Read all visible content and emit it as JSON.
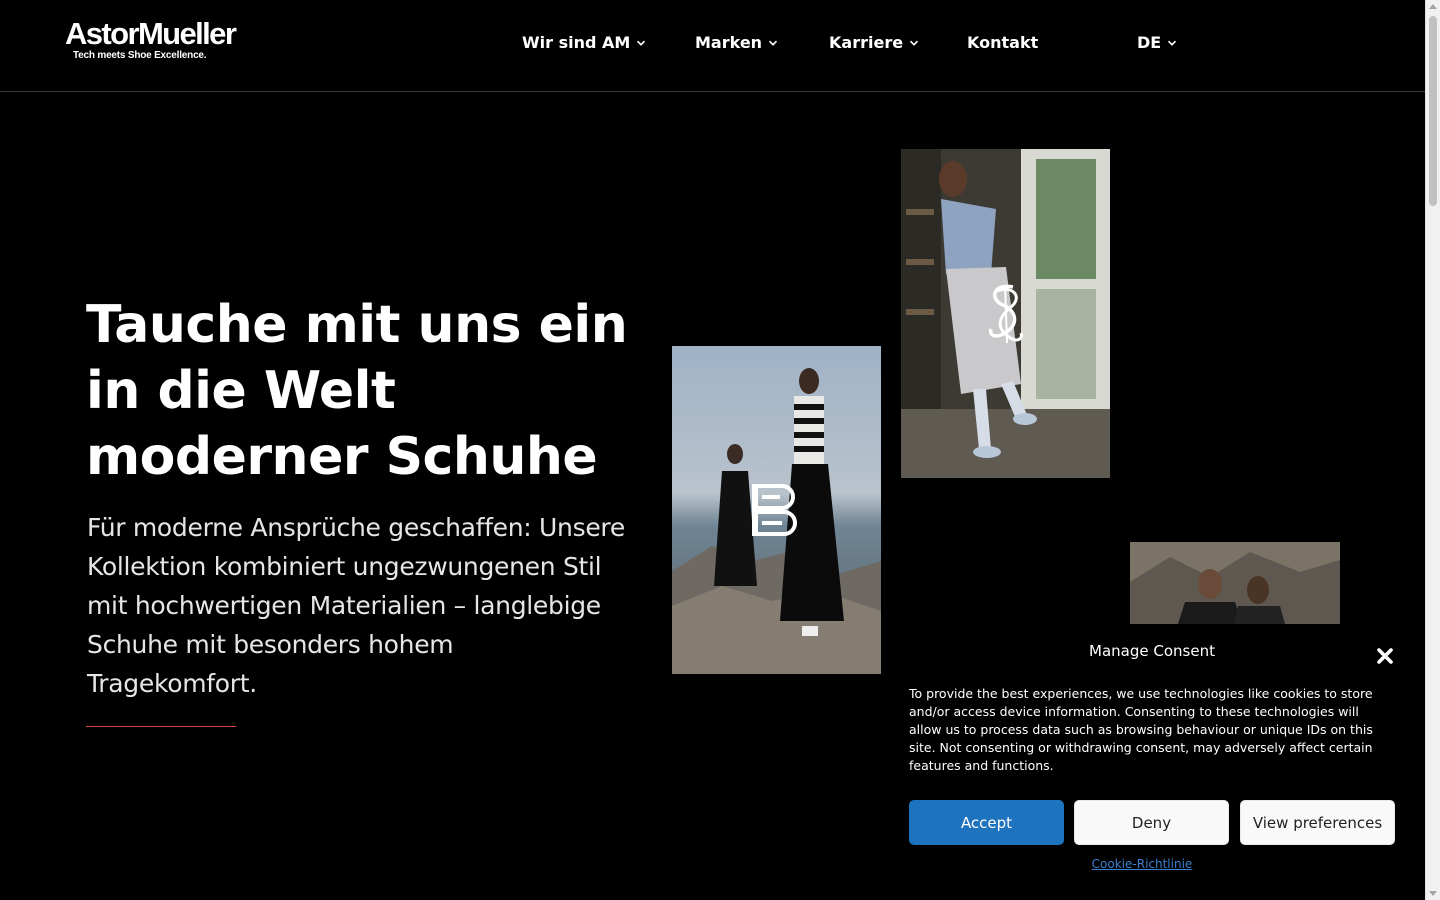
{
  "header": {
    "logo_main": "AstorMueller",
    "logo_sub": "Tech meets Shoe Excellence.",
    "nav": [
      {
        "label": "Wir sind AM",
        "has_dropdown": true
      },
      {
        "label": "Marken",
        "has_dropdown": true
      },
      {
        "label": "Karriere",
        "has_dropdown": true
      },
      {
        "label": "Kontakt",
        "has_dropdown": false
      },
      {
        "label": "DE",
        "has_dropdown": true
      }
    ]
  },
  "hero": {
    "title": "Tauche mit uns ein in die Welt moderner Schuhe",
    "text": "Für moderne Ansprüche geschaffen: Unsere Kollektion kombiniert ungezwungenen Stil mit hochwertigen Materialien – langlebige Schuhe mit besonders hohem Tragekomfort.",
    "accent_color": "#d6453b"
  },
  "photos": [
    {
      "name": "brand-photo-b-coast",
      "brand_icon": "letter-b-logo-icon"
    },
    {
      "name": "brand-photo-s-hallway",
      "brand_icon": "intertwined-s-logo-icon"
    },
    {
      "name": "brand-photo-mountains",
      "brand_icon": ""
    }
  ],
  "consent": {
    "title": "Manage Consent",
    "body": "To provide the best experiences, we use technologies like cookies to store and/or access device information. Consenting to these technologies will allow us to process data such as browsing behaviour or unique IDs on this site. Not consenting or withdrawing consent, may adversely affect certain features and functions.",
    "accept_label": "Accept",
    "deny_label": "Deny",
    "prefs_label": "View preferences",
    "policy_link": "Cookie-Richtlinie",
    "accept_color": "#1e73be",
    "link_color": "#3a7fd0"
  }
}
